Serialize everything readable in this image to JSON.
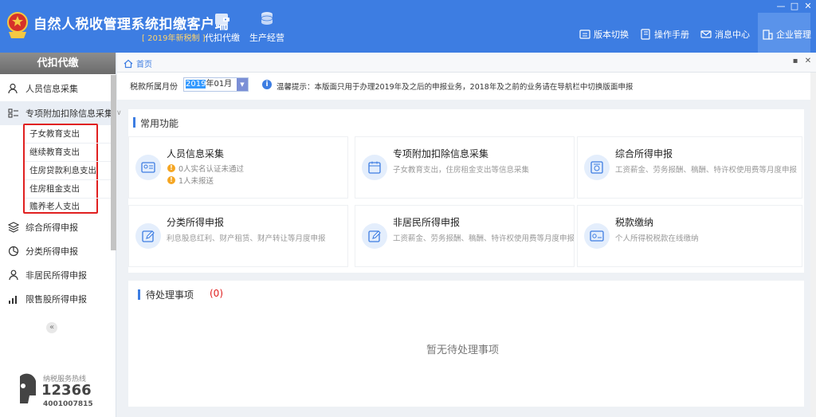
{
  "window": {
    "title": "自然人税收管理系统扣缴客户端",
    "subtitle": "[ 2019年新税制 ]",
    "controls": {
      "minimize": "—",
      "maximize": "□",
      "close": "✕"
    }
  },
  "top_nav": [
    {
      "label": "代扣代缴",
      "icon": "wallet-icon"
    },
    {
      "label": "生产经营",
      "icon": "coins-icon"
    }
  ],
  "header_actions": {
    "version_switch": "版本切换",
    "manual": "操作手册",
    "messages": "消息中心",
    "enterprise": "企业管理"
  },
  "sidebar": {
    "title": "代扣代缴",
    "items": {
      "personnel": "人员信息采集",
      "special_deduction": "专项附加扣除信息采集",
      "comprehensive": "综合所得申报",
      "classified": "分类所得申报",
      "nonresident": "非居民所得申报",
      "restricted_stock": "限售股所得申报"
    },
    "sub_items": [
      "子女教育支出",
      "继续教育支出",
      "住房贷款利息支出",
      "住房租金支出",
      "赡养老人支出"
    ],
    "collapse": "«",
    "hotline": {
      "label": "纳税服务热线",
      "number": "12366",
      "sub": "4001007815"
    }
  },
  "tabbar": {
    "home": "首页",
    "ctrl_a": "▪",
    "ctrl_b": "✕"
  },
  "period": {
    "label": "税款所属月份",
    "value_year": "2019",
    "value_rest": "年01月",
    "tip": "温馨提示：本版面只用于办理2019年及之后的申报业务，2018年及之前的业务请在导航栏中切换版面申报"
  },
  "common_functions": {
    "title": "常用功能",
    "cards": {
      "personnel": {
        "title": "人员信息采集",
        "warn1": "0人实名认证未通过",
        "warn2": "1人未报送"
      },
      "special": {
        "title": "专项附加扣除信息采集",
        "desc": "子女教育支出，住房租金支出等信息采集"
      },
      "comprehensive": {
        "title": "综合所得申报",
        "desc": "工资薪金、劳务报酬、稿酬、特许权使用费等月度申报"
      },
      "classified": {
        "title": "分类所得申报",
        "desc": "利息股息红利、财产租赁、财产转让等月度申报"
      },
      "nonresident": {
        "title": "非居民所得申报",
        "desc": "工资薪金、劳务报酬、稿酬、特许权使用费等月度申报"
      },
      "payment": {
        "title": "税款缴纳",
        "desc": "个人所得税税款在线缴纳"
      }
    }
  },
  "pending": {
    "title": "待处理事项",
    "count": "(0)",
    "empty": "暂无待处理事项"
  },
  "colors": {
    "header_blue": "#3d7de2",
    "highlight_red": "#e02020",
    "warn_orange": "#f5a623"
  }
}
